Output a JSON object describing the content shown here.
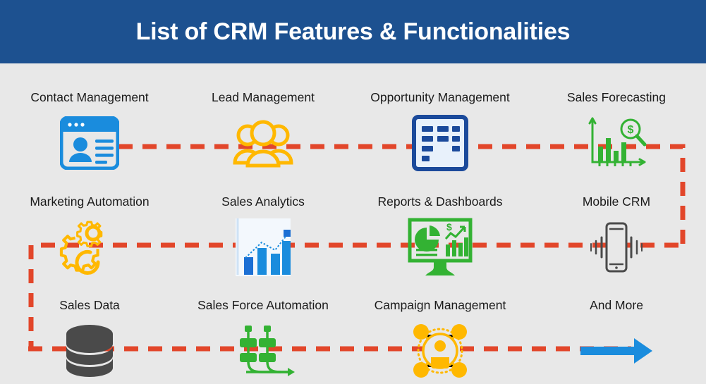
{
  "header": {
    "title": "List of CRM Features & Functionalities",
    "background_color": "#1d5190",
    "text_color": "#ffffff"
  },
  "page": {
    "background_color": "#e8e8e8",
    "label_color": "#1b1b1b",
    "connector_color": "#e2462a"
  },
  "palette": {
    "blue": "#1a8cdd",
    "navy": "#1b4a9b",
    "amber": "#ffb800",
    "green": "#33b233",
    "gray": "#4a4a4a",
    "orange_dash": "#e2462a",
    "arrow_blue": "#1a8cdd"
  },
  "features": [
    {
      "label": "Contact Management",
      "icon": "contact-card-icon",
      "color": "#1a8cdd",
      "row": 1,
      "col": 1
    },
    {
      "label": "Lead Management",
      "icon": "people-group-icon",
      "color": "#ffb800",
      "row": 1,
      "col": 2
    },
    {
      "label": "Opportunity Management",
      "icon": "kanban-board-icon",
      "color": "#1b4a9b",
      "row": 1,
      "col": 3
    },
    {
      "label": "Sales Forecasting",
      "icon": "bar-chart-magnifier-dollar-icon",
      "color": "#33b233",
      "row": 1,
      "col": 4
    },
    {
      "label": "Marketing Automation",
      "icon": "gears-icon",
      "color": "#ffb800",
      "row": 2,
      "col": 1
    },
    {
      "label": "Sales Analytics",
      "icon": "bar-chart-trend-icon",
      "color": "#1a8cdd",
      "row": 2,
      "col": 2
    },
    {
      "label": "Reports & Dashboards",
      "icon": "monitor-dashboard-icon",
      "color": "#33b233",
      "row": 2,
      "col": 3
    },
    {
      "label": "Mobile CRM",
      "icon": "smartphone-signal-icon",
      "color": "#4a4a4a",
      "row": 2,
      "col": 4
    },
    {
      "label": "Sales Data",
      "icon": "database-cylinder-icon",
      "color": "#4a4a4a",
      "row": 3,
      "col": 1
    },
    {
      "label": "Sales Force Automation",
      "icon": "workflow-pipeline-icon",
      "color": "#33b233",
      "row": 3,
      "col": 2
    },
    {
      "label": "Campaign Management",
      "icon": "network-person-icon",
      "color": "#ffb800",
      "row": 3,
      "col": 3
    },
    {
      "label": "And More",
      "icon": "right-arrow-icon",
      "color": "#1a8cdd",
      "row": 3,
      "col": 4
    }
  ]
}
